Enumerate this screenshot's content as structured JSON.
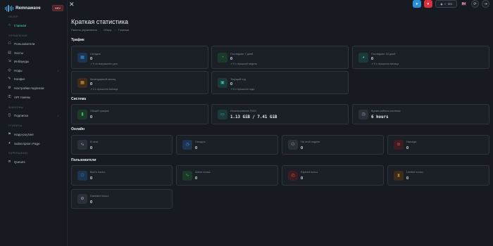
{
  "sidebar": {
    "logo_text": "Remnawave",
    "badge": "DEV",
    "sections": [
      {
        "label": "Обзор",
        "items": [
          {
            "label": "Главная",
            "icon": "star-icon",
            "active": true
          }
        ]
      },
      {
        "label": "Управление",
        "items": [
          {
            "label": "Пользователи",
            "icon": "users-icon"
          },
          {
            "label": "Хосты",
            "icon": "hosts-icon"
          },
          {
            "label": "Инбаунды",
            "icon": "inbounds-icon"
          },
          {
            "label": "Ноды",
            "icon": "nodes-icon",
            "chevron": true
          },
          {
            "label": "Конфиг",
            "icon": "config-icon"
          },
          {
            "label": "Настройки подписки",
            "icon": "subscription-settings-icon"
          },
          {
            "label": "API токены",
            "icon": "api-tokens-icon"
          }
        ]
      },
      {
        "label": "Шаблоны",
        "items": [
          {
            "label": "Подписка",
            "icon": "braces-icon",
            "chevron": true
          }
        ]
      },
      {
        "label": "Утилиты",
        "items": [
          {
            "label": "Happ-роутинг",
            "icon": "routing-icon"
          },
          {
            "label": "Subscription Page",
            "icon": "subscription-page-icon"
          }
        ]
      },
      {
        "label": "Superadmin",
        "items": [
          {
            "label": "Queues",
            "icon": "queues-icon"
          }
        ]
      }
    ]
  },
  "topbar": {
    "close_icon": "close-icon",
    "github_stars": "374",
    "language_flag": "🇬🇧"
  },
  "page": {
    "title": "Краткая статистика",
    "breadcrumb": [
      "Панель управления",
      "Обзор",
      "Главная"
    ]
  },
  "groups": {
    "traffic": "Трафик",
    "system": "Система",
    "online": "Онлайн",
    "users": "Пользователи"
  },
  "traffic_cards": [
    {
      "label": "Сегодня",
      "value": "0",
      "delta": "0 со вчерашнего дня",
      "icon": "calendar-icon",
      "color": "#2f7ad9"
    },
    {
      "label": "Последние 7 дней",
      "value": "0",
      "delta": "0 с прошлой недели",
      "icon": "chart-pie-icon",
      "color": "#2ea043"
    },
    {
      "label": "Последние 30 дней",
      "value": "0",
      "delta": "0 с прошлого месяца",
      "icon": "chart-pie-icon",
      "color": "#3aa3a0"
    },
    {
      "label": "Календарный месяц",
      "value": "0",
      "delta": "0 с прошлого месяца",
      "icon": "calendar-month-icon",
      "color": "#d6882f"
    },
    {
      "label": "Текущий год",
      "value": "0",
      "delta": "0 с прошлого года",
      "icon": "calendar-year-icon",
      "color": "#3aa3a0"
    }
  ],
  "system_cards": [
    {
      "label": "Общий трафик",
      "value": "0",
      "icon": "bar-chart-icon",
      "color": "#2ea043"
    },
    {
      "label": "Использование RAM",
      "value": "1.13 GiB / 7.41 GiB",
      "icon": "memory-icon",
      "color": "#3aa3a0"
    },
    {
      "label": "Время работы системы",
      "value": "6 hours",
      "icon": "clock-icon",
      "color": "#8b95a1"
    }
  ],
  "online_cards": [
    {
      "label": "В сети",
      "value": "0",
      "icon": "activity-icon",
      "color": "#8b95a1"
    },
    {
      "label": "Сегодня",
      "value": "0",
      "icon": "clock-icon",
      "color": "#2f7ad9"
    },
    {
      "label": "На этой неделе",
      "value": "0",
      "icon": "users-icon",
      "color": "#8b95a1"
    },
    {
      "label": "Никогда",
      "value": "0",
      "icon": "ban-icon",
      "color": "#d9303e"
    }
  ],
  "users_cards": [
    {
      "label": "Всего польз.",
      "value": "0",
      "icon": "users-icon",
      "color": "#2f7ad9"
    },
    {
      "label": "Active польз.",
      "value": "0",
      "icon": "activity-icon",
      "color": "#2ea043"
    },
    {
      "label": "Expired польз.",
      "value": "0",
      "icon": "alarm-icon",
      "color": "#d9303e"
    },
    {
      "label": "Limited польз.",
      "value": "0",
      "icon": "hourglass-icon",
      "color": "#d6882f"
    },
    {
      "label": "Disabled польз.",
      "value": "0",
      "icon": "ban-icon",
      "color": "#8b95a1"
    }
  ]
}
